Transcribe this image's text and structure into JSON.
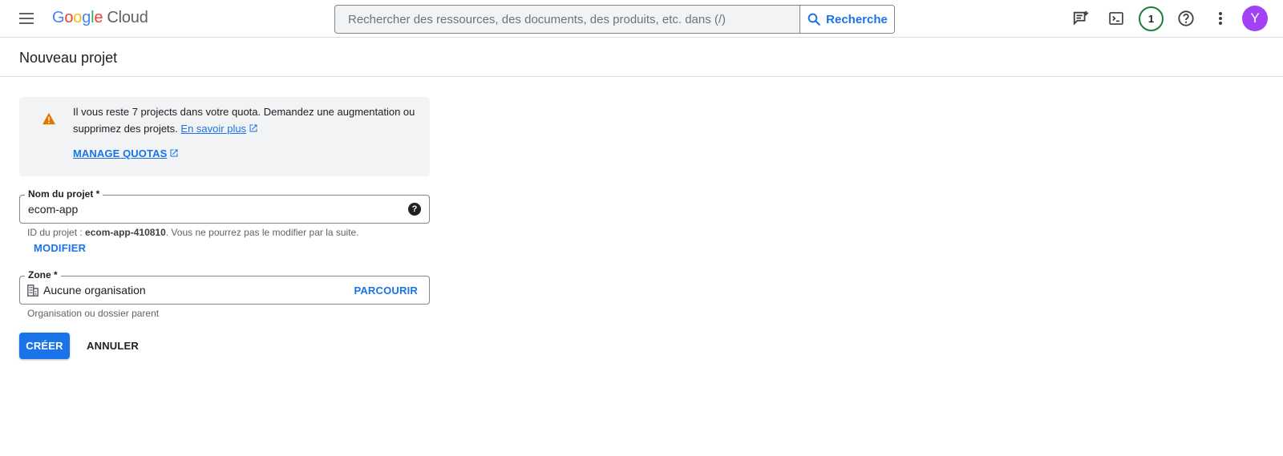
{
  "header": {
    "logo": {
      "google_letters": [
        "G",
        "o",
        "o",
        "g",
        "l",
        "e"
      ],
      "product": "Cloud"
    },
    "search": {
      "placeholder": "Rechercher des ressources, des documents, des produits, etc. dans (/)",
      "button_label": "Recherche"
    },
    "notification_count": "1",
    "avatar_initial": "Y",
    "icons": [
      "menu-icon",
      "search-icon",
      "feedback-icon",
      "terminal-icon",
      "help-circle-icon",
      "more-vert-icon"
    ]
  },
  "page": {
    "title": "Nouveau projet"
  },
  "notice": {
    "line1": "Il vous reste 7 projects dans votre quota. Demandez une augmentation ou",
    "line2_prefix": "supprimez des projets. ",
    "learn_more": "En savoir plus",
    "manage_quotas": "MANAGE QUOTAS"
  },
  "form": {
    "project_name": {
      "label": "Nom du projet *",
      "value": "ecom-app",
      "id_hint_prefix": "ID du projet : ",
      "id_value": "ecom-app-410810",
      "id_hint_suffix": ". Vous ne pourrez pas le modifier par la suite.",
      "modify_label": "MODIFIER"
    },
    "zone": {
      "label": "Zone *",
      "value": "Aucune organisation",
      "browse_label": "PARCOURIR",
      "hint": "Organisation ou dossier parent"
    },
    "create_label": "CRÉER",
    "cancel_label": "ANNULER"
  },
  "colors": {
    "accent": "#1a73e8",
    "warning": "#e37400",
    "avatar": "#a142f4",
    "badge_ring": "#188038"
  }
}
